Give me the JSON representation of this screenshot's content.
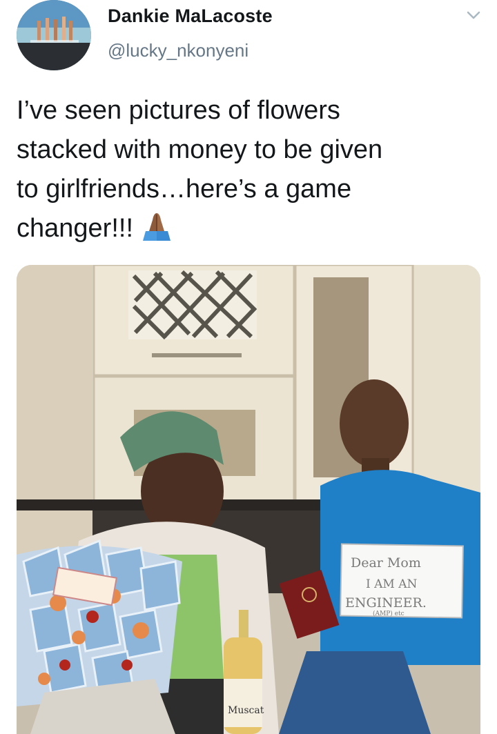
{
  "tweet": {
    "display_name": "Dankie MaLacoste",
    "handle": "@lucky_nkonyeni",
    "text_lines": [
      "I’ve seen pictures of flowers",
      "stacked with money to be given",
      "to girlfriends…here’s a game",
      "changer!!!"
    ],
    "emoji": "folded-hands"
  },
  "photo": {
    "sign_lines": [
      "Dear Mom",
      "I AM AN",
      "ENGINEER.",
      "(AMP) etc"
    ],
    "bottle_label": "Muscat"
  },
  "icons": {
    "menu": "chevron-down-icon",
    "emoji": "folded-hands-icon"
  },
  "colors": {
    "text": "#14171a",
    "secondary_text": "#657786",
    "background": "#ffffff"
  }
}
